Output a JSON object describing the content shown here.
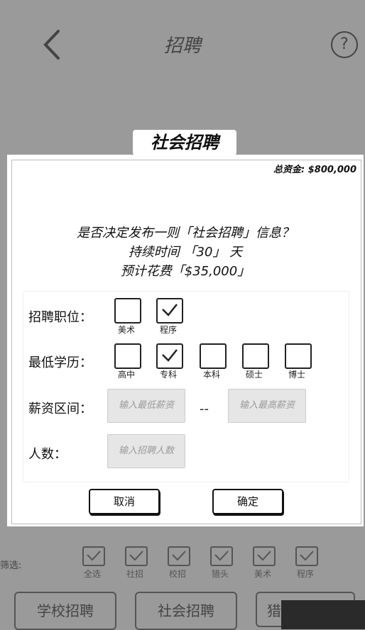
{
  "header": {
    "title": "招聘",
    "help_icon": "?"
  },
  "dialog": {
    "tab_title": "社会招聘",
    "total_funds": "总资金: $800,000",
    "question_lines": [
      "是否决定发布一则「社会招聘」信息？",
      "持续时间 「30」 天",
      "预计花费「$35,000」"
    ],
    "position_label": "招聘职位：",
    "positions": [
      {
        "label": "美术",
        "checked": false
      },
      {
        "label": "程序",
        "checked": true
      }
    ],
    "education_label": "最低学历：",
    "education": [
      {
        "label": "高中",
        "checked": false
      },
      {
        "label": "专科",
        "checked": true
      },
      {
        "label": "本科",
        "checked": false
      },
      {
        "label": "硕士",
        "checked": false
      },
      {
        "label": "博士",
        "checked": false
      }
    ],
    "salary_label": "薪资区间：",
    "salary_min_placeholder": "输入最低薪资",
    "salary_sep": "--",
    "salary_max_placeholder": "输入最高薪资",
    "headcount_label": "人数：",
    "headcount_placeholder": "输入招聘人数",
    "cancel_label": "取消",
    "confirm_label": "确定"
  },
  "filter": {
    "label": "筛选:",
    "options": [
      {
        "label": "全选",
        "checked": true
      },
      {
        "label": "社招",
        "checked": true
      },
      {
        "label": "校招",
        "checked": true
      },
      {
        "label": "猎头",
        "checked": true
      },
      {
        "label": "美术",
        "checked": true
      },
      {
        "label": "程序",
        "checked": true
      }
    ]
  },
  "tabs": [
    {
      "label": "学校招聘"
    },
    {
      "label": "社会招聘"
    },
    {
      "label": "猎"
    }
  ]
}
